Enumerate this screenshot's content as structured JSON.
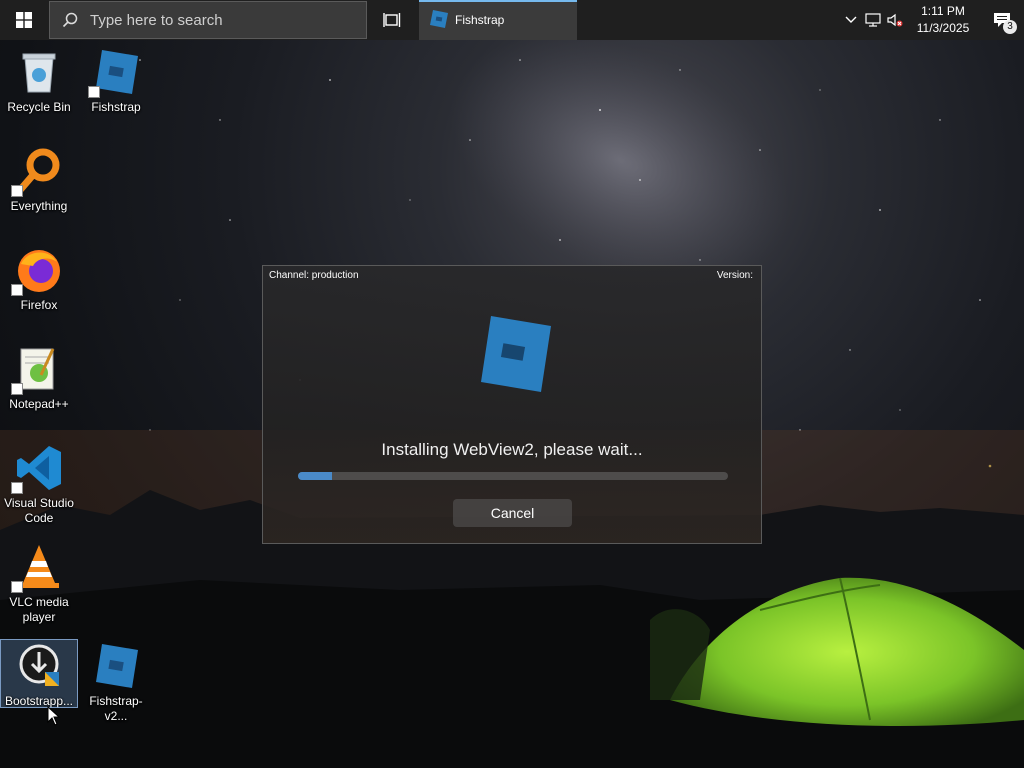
{
  "taskbar": {
    "start_icon": "windows-logo-icon",
    "search_placeholder": "Type here to search",
    "task_view_icon": "task-view-icon",
    "active_app": {
      "label": "Fishstrap",
      "icon": "fishstrap-icon"
    },
    "tray": {
      "chevron_icon": "chevron-up-icon",
      "network_icon": "network-icon",
      "volume_icon": "volume-muted-icon",
      "time": "1:11 PM",
      "date": "11/3/2025",
      "notification_count": "3"
    }
  },
  "desktop": {
    "icons": [
      {
        "label": "Recycle Bin",
        "icon": "recycle-bin-icon"
      },
      {
        "label": "Fishstrap",
        "icon": "fishstrap-icon"
      },
      {
        "label": "Everything",
        "icon": "everything-search-icon"
      },
      {
        "label": "Firefox",
        "icon": "firefox-icon"
      },
      {
        "label": "Notepad++",
        "icon": "notepad-plus-plus-icon"
      },
      {
        "label": "Visual Studio Code",
        "icon": "vscode-icon"
      },
      {
        "label": "VLC media player",
        "icon": "vlc-icon"
      },
      {
        "label": "Bootstrapp...",
        "icon": "bootstrapper-installer-icon"
      },
      {
        "label": "Fishstrap-v2...",
        "icon": "fishstrap-icon"
      }
    ]
  },
  "dialog": {
    "channel": "Channel: production",
    "version": "Version:",
    "status": "Installing WebView2, please wait...",
    "progress": 0.08,
    "cancel_label": "Cancel",
    "accent": "#4a8ac8"
  }
}
